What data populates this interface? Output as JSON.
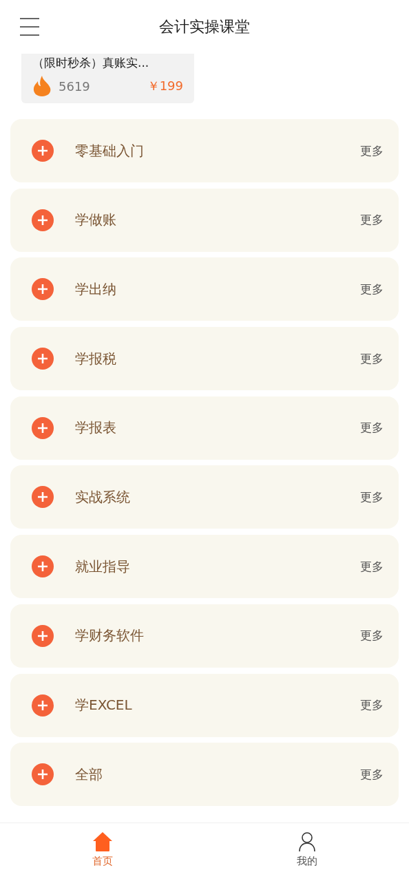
{
  "header": {
    "title": "会计实操课堂"
  },
  "course_card": {
    "title": "（限时秒杀）真账实...",
    "views": "5619",
    "price": "￥199"
  },
  "categories": [
    {
      "label": "零基础入门",
      "more": "更多"
    },
    {
      "label": "学做账",
      "more": "更多"
    },
    {
      "label": "学出纳",
      "more": "更多"
    },
    {
      "label": "学报税",
      "more": "更多"
    },
    {
      "label": "学报表",
      "more": "更多"
    },
    {
      "label": "实战系统",
      "more": "更多"
    },
    {
      "label": "就业指导",
      "more": "更多"
    },
    {
      "label": "学财务软件",
      "more": "更多"
    },
    {
      "label": "学EXCEL",
      "more": "更多"
    },
    {
      "label": "全部",
      "more": "更多"
    }
  ],
  "tab_bar": [
    {
      "kind": "home",
      "label": "首页",
      "selected": true
    },
    {
      "kind": "profile",
      "label": "我的",
      "selected": false
    }
  ]
}
